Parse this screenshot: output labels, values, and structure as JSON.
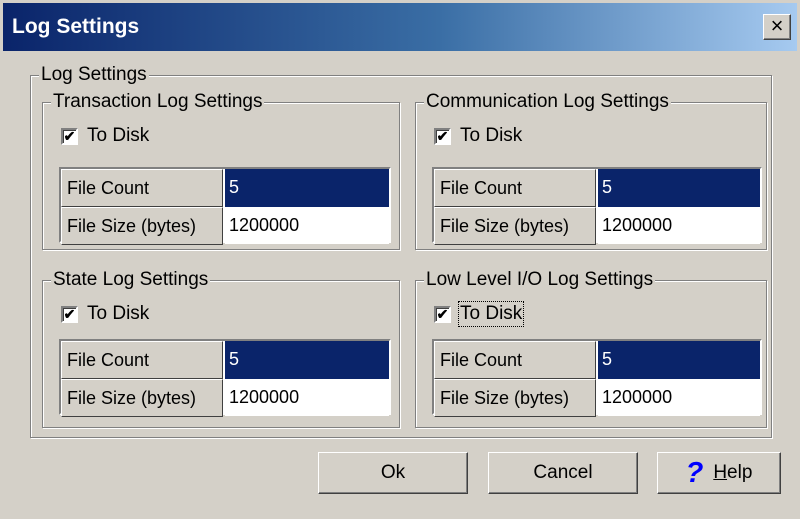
{
  "window": {
    "title": "Log Settings",
    "close_label": "×"
  },
  "main_group": {
    "label": "Log Settings"
  },
  "groups": [
    {
      "label": "Transaction Log Settings",
      "to_disk_label": "To Disk",
      "to_disk_checked": true,
      "rows": [
        {
          "label": "File Count",
          "value": "5"
        },
        {
          "label": "File Size (bytes)",
          "value": "1200000"
        }
      ]
    },
    {
      "label": "Communication Log Settings",
      "to_disk_label": "To Disk",
      "to_disk_checked": true,
      "rows": [
        {
          "label": "File Count",
          "value": "5"
        },
        {
          "label": "File Size (bytes)",
          "value": "1200000"
        }
      ]
    },
    {
      "label": "State Log Settings",
      "to_disk_label": "To Disk",
      "to_disk_checked": true,
      "rows": [
        {
          "label": "File Count",
          "value": "5"
        },
        {
          "label": "File Size (bytes)",
          "value": "1200000"
        }
      ]
    },
    {
      "label": "Low Level I/O Log Settings",
      "to_disk_label": "To Disk",
      "to_disk_checked": true,
      "rows": [
        {
          "label": "File Count",
          "value": "5"
        },
        {
          "label": "File Size (bytes)",
          "value": "1200000"
        }
      ]
    }
  ],
  "check_glyph": "✔",
  "buttons": {
    "ok": "Ok",
    "cancel": "Cancel",
    "help_mnemonic": "H",
    "help_rest": "elp",
    "help_icon": "?"
  }
}
